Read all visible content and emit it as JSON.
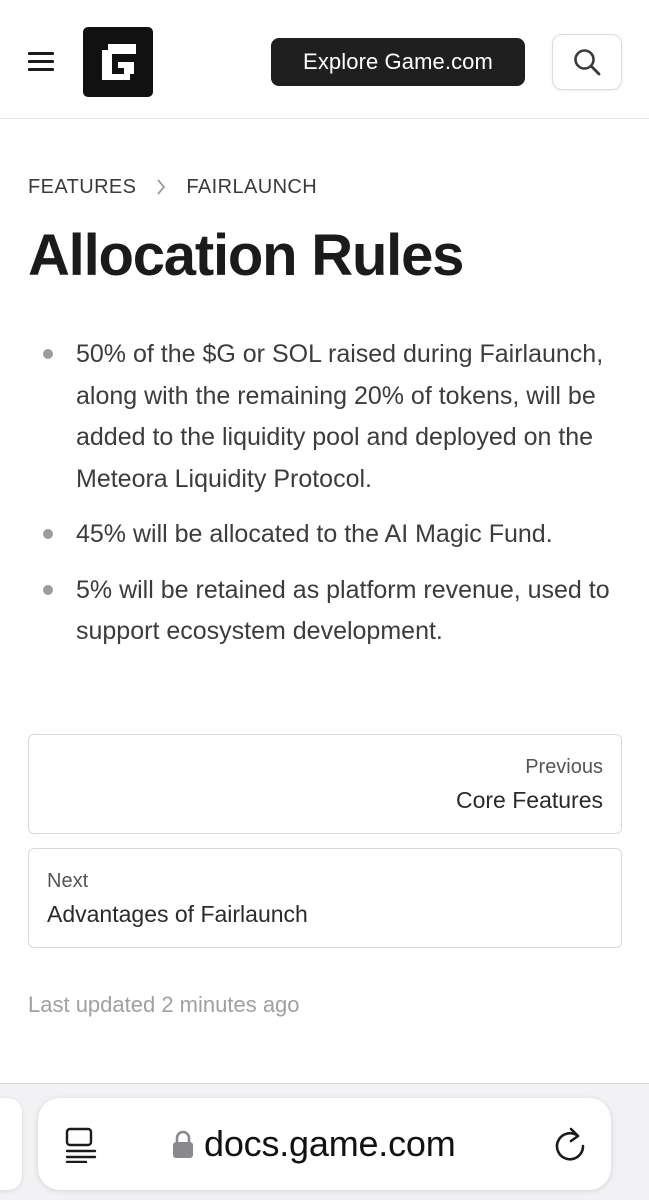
{
  "header": {
    "explore_label": "Explore Game.com"
  },
  "breadcrumb": {
    "items": [
      "FEATURES",
      "FAIRLAUNCH"
    ]
  },
  "page": {
    "title": "Allocation Rules",
    "bullets": [
      "50% of the $G or SOL raised during Fairlaunch, along with the remaining 20% of tokens, will be added to the liquidity pool and deployed on the Meteora Liquidity Protocol.",
      "45% will be allocated to the AI Magic Fund.",
      "5% will be retained as platform revenue, used to support ecosystem development."
    ]
  },
  "pagination": {
    "prev_label": "Previous",
    "prev_title": "Core Features",
    "next_label": "Next",
    "next_title": "Advantages of Fairlaunch"
  },
  "footer": {
    "last_updated": "Last updated 2 minutes ago"
  },
  "browser": {
    "url": "docs.game.com"
  },
  "icons": {
    "menu": "hamburger-menu-icon",
    "logo": "game-g-logo",
    "search": "search-icon",
    "chevron": "chevron-right-icon",
    "reader": "reader-mode-icon",
    "lock": "lock-icon",
    "reload": "reload-icon"
  },
  "colors": {
    "text": "#1b1b1d",
    "button_dark": "#1f1f1f",
    "muted": "#a0a0a2",
    "border": "#d9d9d9"
  }
}
